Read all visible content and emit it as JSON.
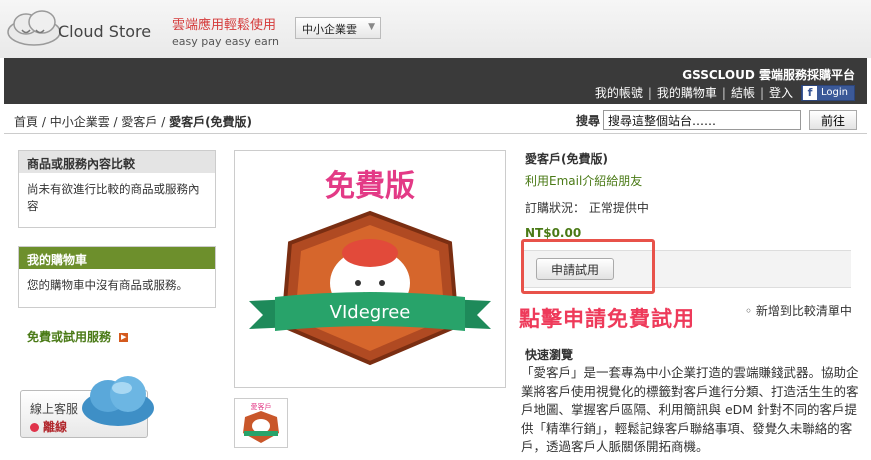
{
  "header": {
    "brand": "Cloud Store",
    "tagline_zh": "雲端應用輕鬆使用",
    "tagline_en": "easy pay easy earn",
    "category_select": "中小企業雲"
  },
  "topnav": {
    "platform": "GSSCLOUD 雲端服務採購平台",
    "links": [
      "我的帳號",
      "我的購物車",
      "結帳",
      "登入"
    ],
    "fb_login": "Login"
  },
  "breadcrumb": {
    "items": [
      "首頁",
      "中小企業雲",
      "愛客戶"
    ],
    "current": "愛客戶(免費版)"
  },
  "search": {
    "label": "搜尋",
    "value": "搜尋這整個站台……",
    "button": "前往"
  },
  "sidebar": {
    "compare_title": "商品或服務內容比較",
    "compare_body": "尚未有欲進行比較的商品或服務內容",
    "cart_title": "我的購物車",
    "cart_body": "您的購物車中沒有商品或服務。",
    "free_link": "免費或試用服務",
    "support_title": "線上客服",
    "support_status": "離線"
  },
  "product": {
    "badge_title": "免費版",
    "badge_name": "VIdegree",
    "badge_thumb": "愛客戶",
    "name": "愛客戶(免費版)",
    "share": "利用Email介紹給朋友",
    "status_label": "訂購狀況：",
    "status_value": "正常提供中",
    "price": "NT$0.00",
    "try_button": "申請試用",
    "annotation": "點擊申請免費試用",
    "compare_add": "新增到比較清單中",
    "quick_title": "快速瀏覽",
    "description": "「愛客戶」是一套專為中小企業打造的雲端賺錢武器。協助企業將客戶使用視覺化的標籤對客戶進行分類、打造活生生的客戶地圖、掌握客戶區隔、利用簡訊與 eDM 針對不同的客戶提供「精準行銷」，輕鬆記錄客戶聯絡事項、發覺久未聯絡的客戶，透過客戶人脈關係開拓商機。"
  },
  "colors": {
    "accent_green": "#4a7a16",
    "highlight_red": "#e8524a",
    "annotation_pink": "#ee3a5a",
    "dark_bar": "#3a3a3a"
  }
}
